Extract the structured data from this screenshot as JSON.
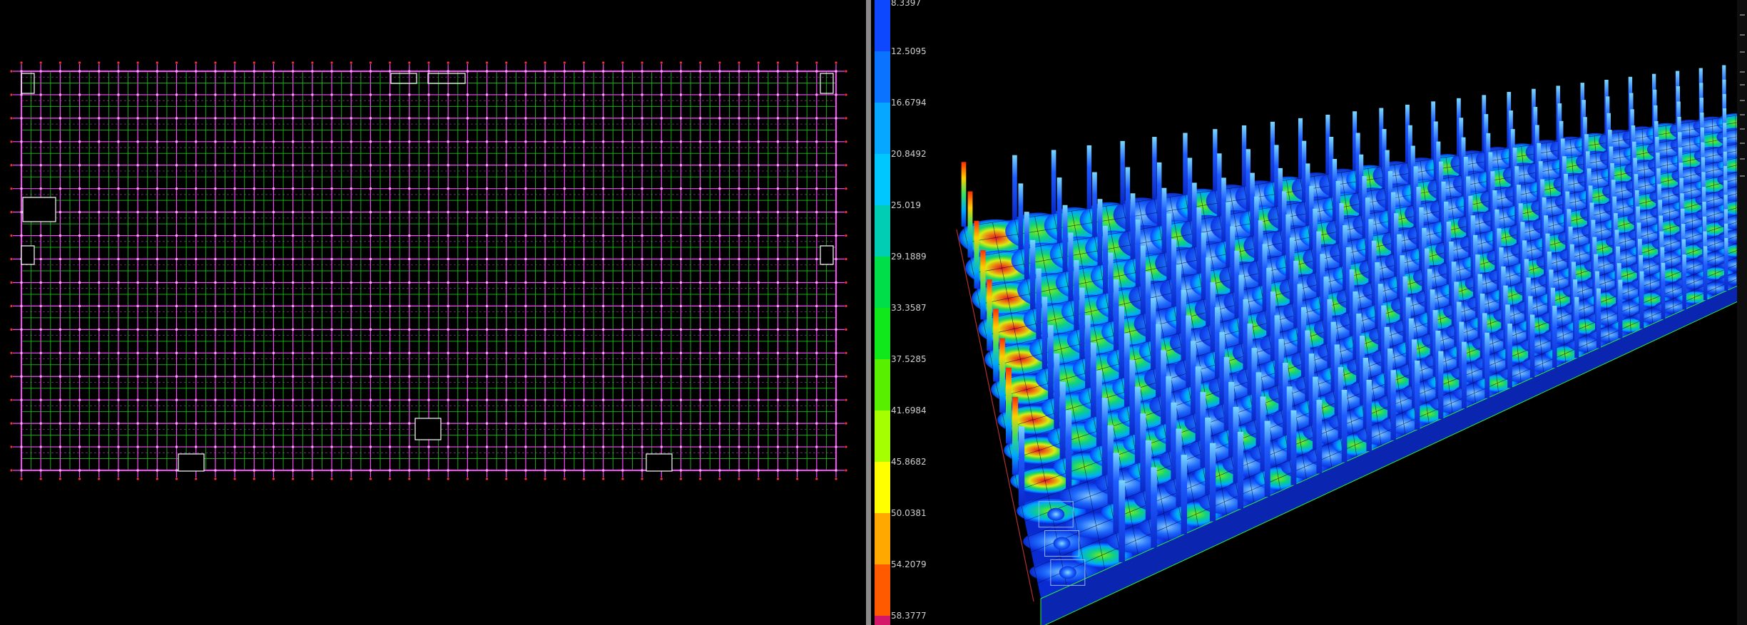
{
  "colors": {
    "background": "#000000",
    "divider": "#8a8a8a",
    "plan_beam": "#ff46ff",
    "plan_slab_line": "#19c919",
    "plan_node": "#ff3030"
  },
  "legend": {
    "ranges": [
      {
        "label": "8.3397",
        "color": "#0d48ff"
      },
      {
        "label": "12.5095",
        "color": "#0a73ff"
      },
      {
        "label": "16.6794",
        "color": "#05a7ff"
      },
      {
        "label": "20.8492",
        "color": "#00c8ff"
      },
      {
        "label": "25.019",
        "color": "#00cdb4"
      },
      {
        "label": "29.1889",
        "color": "#00df4a"
      },
      {
        "label": "33.3587",
        "color": "#10e81c"
      },
      {
        "label": "37.5285",
        "color": "#58f000"
      },
      {
        "label": "41.6984",
        "color": "#a5ff00"
      },
      {
        "label": "45.8682",
        "color": "#ffff00"
      },
      {
        "label": "50.0381",
        "color": "#ffa800"
      },
      {
        "label": "54.2079",
        "color": "#ff5a00"
      },
      {
        "label": "58.3777",
        "color": "#ff0d0d"
      }
    ],
    "end_color": "#d5176a"
  },
  "plan_view": {
    "columns": 42,
    "rows": 17
  },
  "model_view": {
    "depth_rows": 12,
    "width_cols": 28
  }
}
